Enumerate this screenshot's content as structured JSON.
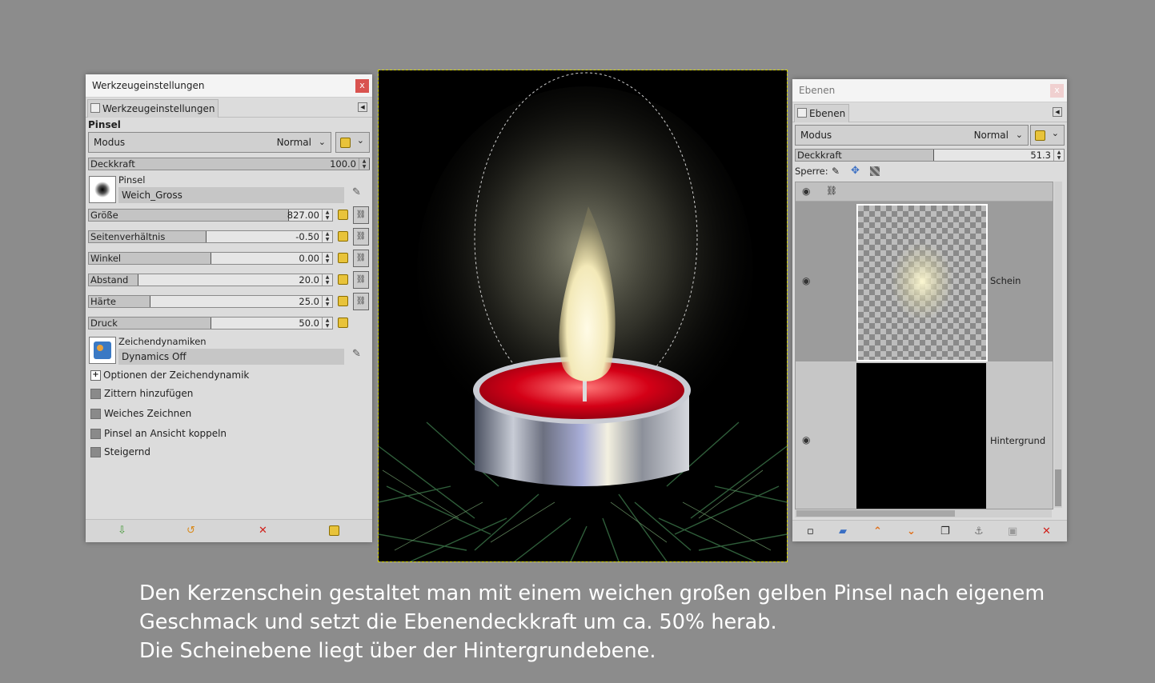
{
  "tool_options": {
    "window_title": "Werkzeugeinstellungen",
    "close_label": "x",
    "tab_label": "Werkzeugeinstellungen",
    "section_title": "Pinsel",
    "mode_label": "Modus",
    "mode_value": "Normal",
    "opacity": {
      "label": "Deckkraft",
      "value": "100.0",
      "fraction": 1.0
    },
    "brush_label": "Pinsel",
    "brush_name": "Weich_Gross",
    "sliders": [
      {
        "label": "Größe",
        "value": "827.00",
        "fraction": 0.82
      },
      {
        "label": "Seitenverhältnis",
        "value": "-0.50",
        "fraction": 0.48
      },
      {
        "label": "Winkel",
        "value": "0.00",
        "fraction": 0.5
      },
      {
        "label": "Abstand",
        "value": "20.0",
        "fraction": 0.2
      },
      {
        "label": "Härte",
        "value": "25.0",
        "fraction": 0.25
      },
      {
        "label": "Druck",
        "value": "50.0",
        "fraction": 0.5
      }
    ],
    "dynamics_label": "Zeichendynamiken",
    "dynamics_value": "Dynamics Off",
    "dynamics_options_label": "Optionen der Zeichendynamik",
    "checkboxes": [
      {
        "label": "Zittern hinzufügen"
      },
      {
        "label": "Weiches Zeichnen"
      },
      {
        "label": "Pinsel an Ansicht koppeln"
      },
      {
        "label": "Steigernd"
      }
    ]
  },
  "layers": {
    "window_title": "Ebenen",
    "close_label": "x",
    "tab_label": "Ebenen",
    "mode_label": "Modus",
    "mode_value": "Normal",
    "opacity": {
      "label": "Deckkraft",
      "value": "51.3",
      "fraction": 0.513
    },
    "lock_label": "Sperre:",
    "items": [
      {
        "name": "Schein",
        "visible": true,
        "selected": false
      },
      {
        "name": "Hintergrund",
        "visible": true,
        "selected": true
      }
    ]
  },
  "caption": {
    "line1": "Den Kerzenschein gestaltet man mit einem weichen großen gelben Pinsel nach eigenem",
    "line2": "Geschmack und setzt die Ebenendeckkraft um ca. 50% herab.",
    "line3": "Die Scheinebene liegt über der Hintergrundebene."
  },
  "colors": {
    "background": "#8c8c8c",
    "candle_wax": "#c8001a",
    "flame": "#fff6d0",
    "close_red": "#d9534f",
    "reset_yellow": "#e8c33a"
  }
}
